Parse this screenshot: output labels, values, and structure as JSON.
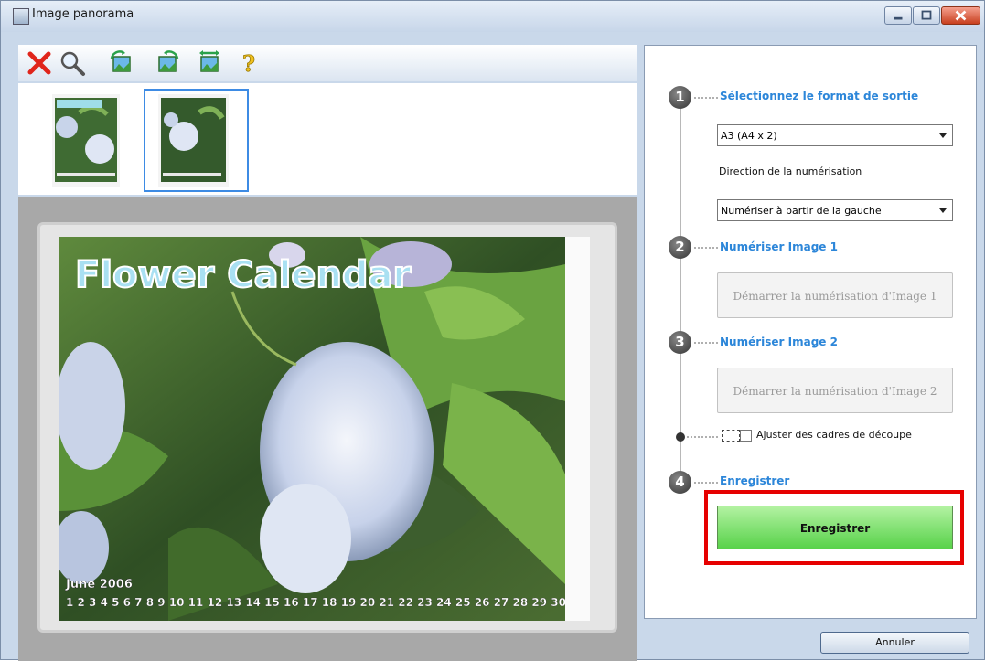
{
  "window": {
    "title": "Image panorama"
  },
  "toolbar": {
    "items": [
      {
        "name": "delete",
        "icon": "red-x-icon"
      },
      {
        "name": "zoom",
        "icon": "magnifier-icon"
      },
      {
        "name": "rotate-left",
        "icon": "rotate-left-icon"
      },
      {
        "name": "rotate-right",
        "icon": "rotate-right-icon"
      },
      {
        "name": "flip",
        "icon": "flip-icon"
      },
      {
        "name": "help",
        "icon": "question-icon"
      }
    ]
  },
  "preview": {
    "photo_title": "Flower Calendar",
    "month": "June 2006",
    "days": "1 2 3 4 5 6 7 8 9 10 11 12 13 14 15 16 17 18 19 20 21 22 23 24 25 26 27 28 29 30"
  },
  "steps": [
    {
      "number": "1",
      "title": "Sélectionnez le format de sortie"
    },
    {
      "number": "2",
      "title": "Numériser Image 1"
    },
    {
      "number": "3",
      "title": "Numériser Image 2"
    },
    {
      "number": "4",
      "title": "Enregistrer"
    }
  ],
  "output_format": {
    "selected": "A3 (A4 x 2)"
  },
  "scan_direction": {
    "label": "Direction de la numérisation",
    "selected": "Numériser à partir de la gauche"
  },
  "scan1_button": "Démarrer la numérisation d'Image 1",
  "scan2_button": "Démarrer la numérisation d'Image 2",
  "crop_checkbox": {
    "label": "Ajuster des cadres de découpe",
    "checked": false
  },
  "save_button": "Enregistrer",
  "cancel_button": "Annuler",
  "colors": {
    "accent": "#2c86d9",
    "highlight": "#e60000",
    "save_green": "#58d24a"
  }
}
